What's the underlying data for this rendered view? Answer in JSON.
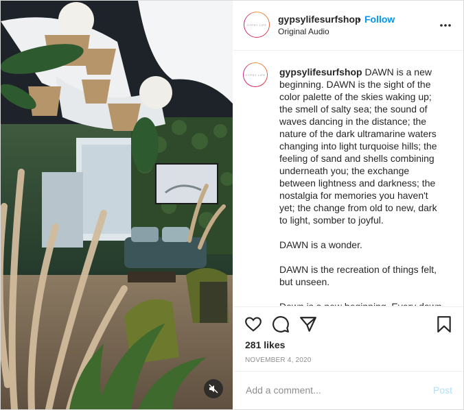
{
  "colors": {
    "accent": "#0095f6",
    "text": "#262626",
    "muted": "#8e8e8e",
    "post_disabled": "#b2dffc"
  },
  "header": {
    "username": "gypsylifesurfshop",
    "separator": "•",
    "follow_label": "Follow",
    "audio_label": "Original Audio",
    "avatar_logo_text": "GYPSY LIFE",
    "more_icon": "more-horizontal-icon"
  },
  "caption": {
    "username": "gypsylifesurfshop",
    "paragraph_1": "DAWN is a new beginning. DAWN is the sight of the color palette of the skies waking up; the smell of salty sea; the sound of waves dancing in the distance; the nature of the dark ultramarine waters changing into light turquoise hills; the feeling of sand and shells combining underneath you; the exchange between lightness and darkness; the nostalgia for memories you haven't yet; the change from old to new, dark to light, somber to joyful.",
    "paragraph_2": "DAWN is a wonder.",
    "paragraph_3": "DAWN is the recreation of things felt, but unseen.",
    "paragraph_4_partial": "Dawn is a new beginning. Every dawn"
  },
  "actions": {
    "like_icon": "heart-icon",
    "comment_icon": "comment-bubble-icon",
    "share_icon": "paper-plane-icon",
    "save_icon": "bookmark-icon",
    "likes": "281 likes",
    "date": "NOVEMBER 4, 2020"
  },
  "comment": {
    "placeholder": "Add a comment...",
    "post_label": "Post"
  },
  "media": {
    "mute_icon": "speaker-muted-icon"
  }
}
